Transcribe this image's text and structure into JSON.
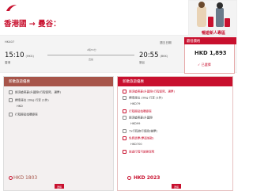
{
  "route": "香港國 → 曼谷：",
  "hero_text": "暢遊新人專區",
  "flight": {
    "number": "HK407",
    "dep_time": "15:10",
    "dep_ampm": "(HKG)",
    "dep_airport": "香港",
    "duration": "2時55分",
    "stops": "直航",
    "arr_date": "週五日期",
    "arr_time": "20:55",
    "arr_ampm": "(BKK)",
    "arr_airport": "曼谷"
  },
  "price_box": {
    "tag": "最低價格",
    "price": "HKD 1,893",
    "selected": "✓ 已選擇"
  },
  "left_panel": {
    "title": "新歡旅遊優惠",
    "rows": [
      "經濟艙燕菱/升國際(行程保障、選票)",
      "標準座位 20kg 行李 (1件)",
      "HKD",
      "行程輕鬆換購優惠"
    ],
    "price": "HKD 1803",
    "button": "選擇"
  },
  "right_panel": {
    "title": "新歡旅遊優惠",
    "rows": [
      {
        "text": "經濟艙燕菱/升國際(行程保障、選票)",
        "red": true
      },
      {
        "text": "標準座位 20kg 行李 (1件)",
        "red": false
      },
      {
        "text": "HKD79",
        "red": false
      },
      {
        "text": "行程輕鬆換購優惠",
        "red": true
      },
      {
        "text": "經濟艙燕菱/升國際",
        "red": false
      },
      {
        "text": "HKD99",
        "red": false
      },
      {
        "text": "7x行程旅行保險(機票)",
        "red": false
      },
      {
        "text": "免費退票(票面條款)",
        "red": true
      },
      {
        "text": "HKD700",
        "red": false
      },
      {
        "text": "旅遊行程可變更保障",
        "red": true
      }
    ],
    "price": "HKD 2023",
    "button": "選擇"
  },
  "colors": {
    "brand": "#c8102e",
    "accent": "#a7554a"
  }
}
